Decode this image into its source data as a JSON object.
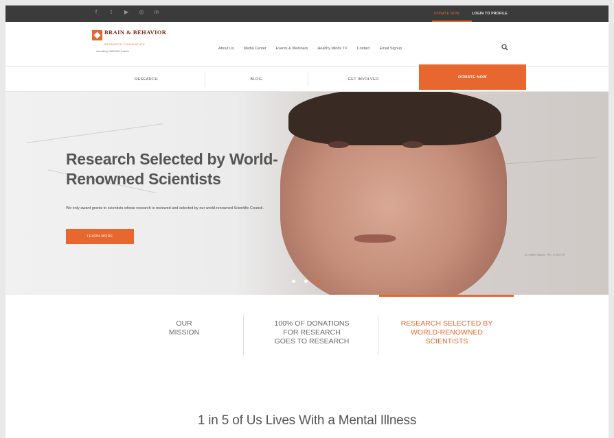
{
  "topbar": {
    "social_icons": [
      "facebook-icon",
      "twitter-icon",
      "youtube-icon",
      "instagram-icon",
      "linkedin-icon"
    ],
    "links": [
      "DONATE NOW",
      "LOGIN TO PROFILE"
    ]
  },
  "header": {
    "logo_name": "BRAIN & BEHAVIOR",
    "logo_sub": "RESEARCH FOUNDATION",
    "logo_tag": "Awarding NARSAD Grants",
    "nav": [
      "About Us",
      "Media Center",
      "Events & Webinars",
      "Healthy Minds TV",
      "Contact",
      "Email Signup"
    ],
    "search_icon": "search-icon"
  },
  "tabs": [
    "RESEARCH",
    "BLOG",
    "GET INVOLVED",
    "DONATE NOW"
  ],
  "hero": {
    "title": "Research Selected by World-Renowned Scientists",
    "text": "We only award grants to scientists whose research is reviewed and selected by our world-renowned Scientific Council.",
    "button": "LEARN MORE",
    "caption": "Dr. Gabriel Gagnon, PhD, SCIENTIST",
    "dots": 3
  },
  "features": [
    {
      "label": "OUR\nMISSION",
      "active": false
    },
    {
      "label": "100% OF DONATIONS\nFOR RESEARCH\nGOES TO RESEARCH",
      "active": false
    },
    {
      "label": "RESEARCH SELECTED BY\nWORLD-RENOWNED\nSCIENTISTS",
      "active": true
    }
  ],
  "headline": "1 in 5 of Us Lives With a Mental Illness",
  "colors": {
    "accent": "#e8672e",
    "dark": "#3b3b3b",
    "text": "#555555"
  }
}
